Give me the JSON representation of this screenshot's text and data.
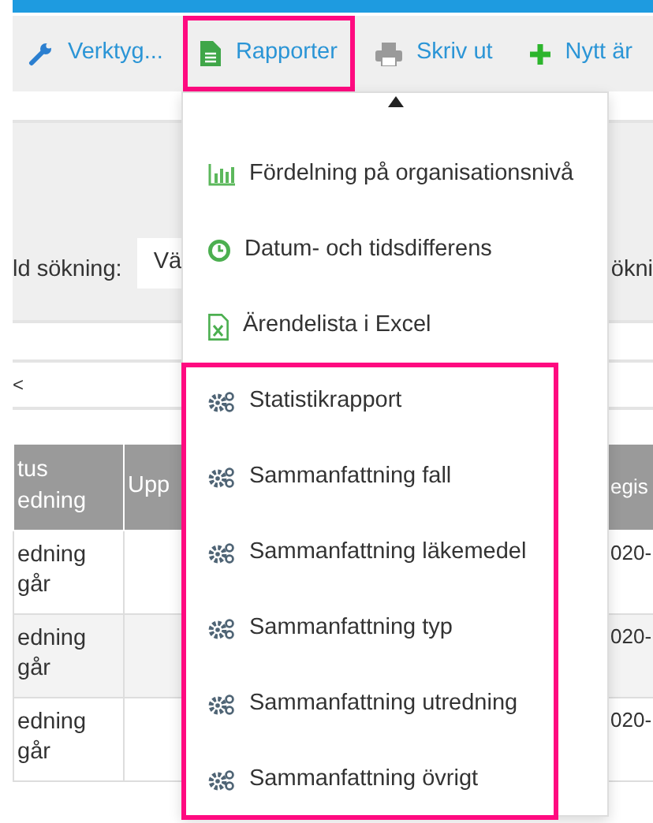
{
  "toolbar": [
    {
      "label": "Verktyg...",
      "kind": "wrench",
      "highlighted": false
    },
    {
      "label": "Rapporter",
      "kind": "document",
      "highlighted": true
    },
    {
      "label": "Skriv ut",
      "kind": "printer",
      "highlighted": false
    },
    {
      "label": "Nytt är",
      "kind": "plus",
      "highlighted": false
    }
  ],
  "search": {
    "label": "ld sökning:",
    "select_value": "Vä",
    "right_label": "ökni"
  },
  "pager": {
    "prev": "<"
  },
  "table": {
    "columns": [
      "tus\nedning",
      "Upp",
      "egis"
    ],
    "rows": [
      [
        "edning\ngår",
        "",
        "020-"
      ],
      [
        "edning\ngår",
        "",
        "020-"
      ],
      [
        "edning\ngår",
        "",
        "020-"
      ]
    ]
  },
  "dropdown": {
    "items": [
      {
        "label": "Fördelning på organisationsnivå",
        "kind": "chart",
        "highlighted": false
      },
      {
        "label": "Datum- och tidsdifferens",
        "kind": "clock",
        "highlighted": false
      },
      {
        "label": "Ärendelista i Excel",
        "kind": "excel",
        "highlighted": false
      },
      {
        "label": "Statistikrapport",
        "kind": "gears",
        "highlighted": true
      },
      {
        "label": "Sammanfattning fall",
        "kind": "gears",
        "highlighted": true
      },
      {
        "label": "Sammanfattning läkemedel",
        "kind": "gears",
        "highlighted": true
      },
      {
        "label": "Sammanfattning typ",
        "kind": "gears",
        "highlighted": true
      },
      {
        "label": "Sammanfattning utredning",
        "kind": "gears",
        "highlighted": true
      },
      {
        "label": "Sammanfattning övrigt",
        "kind": "gears",
        "highlighted": true
      }
    ]
  }
}
